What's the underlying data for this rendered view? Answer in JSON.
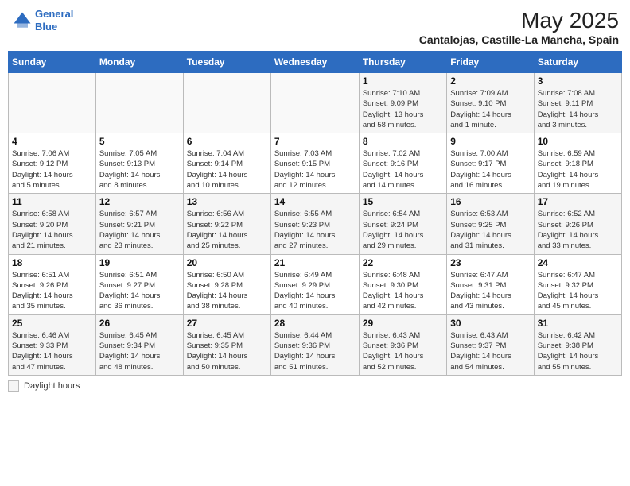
{
  "header": {
    "logo_line1": "General",
    "logo_line2": "Blue",
    "month_year": "May 2025",
    "location": "Cantalojas, Castille-La Mancha, Spain"
  },
  "weekdays": [
    "Sunday",
    "Monday",
    "Tuesday",
    "Wednesday",
    "Thursday",
    "Friday",
    "Saturday"
  ],
  "weeks": [
    [
      {
        "day": "",
        "info": ""
      },
      {
        "day": "",
        "info": ""
      },
      {
        "day": "",
        "info": ""
      },
      {
        "day": "",
        "info": ""
      },
      {
        "day": "1",
        "info": "Sunrise: 7:10 AM\nSunset: 9:09 PM\nDaylight: 13 hours\nand 58 minutes."
      },
      {
        "day": "2",
        "info": "Sunrise: 7:09 AM\nSunset: 9:10 PM\nDaylight: 14 hours\nand 1 minute."
      },
      {
        "day": "3",
        "info": "Sunrise: 7:08 AM\nSunset: 9:11 PM\nDaylight: 14 hours\nand 3 minutes."
      }
    ],
    [
      {
        "day": "4",
        "info": "Sunrise: 7:06 AM\nSunset: 9:12 PM\nDaylight: 14 hours\nand 5 minutes."
      },
      {
        "day": "5",
        "info": "Sunrise: 7:05 AM\nSunset: 9:13 PM\nDaylight: 14 hours\nand 8 minutes."
      },
      {
        "day": "6",
        "info": "Sunrise: 7:04 AM\nSunset: 9:14 PM\nDaylight: 14 hours\nand 10 minutes."
      },
      {
        "day": "7",
        "info": "Sunrise: 7:03 AM\nSunset: 9:15 PM\nDaylight: 14 hours\nand 12 minutes."
      },
      {
        "day": "8",
        "info": "Sunrise: 7:02 AM\nSunset: 9:16 PM\nDaylight: 14 hours\nand 14 minutes."
      },
      {
        "day": "9",
        "info": "Sunrise: 7:00 AM\nSunset: 9:17 PM\nDaylight: 14 hours\nand 16 minutes."
      },
      {
        "day": "10",
        "info": "Sunrise: 6:59 AM\nSunset: 9:18 PM\nDaylight: 14 hours\nand 19 minutes."
      }
    ],
    [
      {
        "day": "11",
        "info": "Sunrise: 6:58 AM\nSunset: 9:20 PM\nDaylight: 14 hours\nand 21 minutes."
      },
      {
        "day": "12",
        "info": "Sunrise: 6:57 AM\nSunset: 9:21 PM\nDaylight: 14 hours\nand 23 minutes."
      },
      {
        "day": "13",
        "info": "Sunrise: 6:56 AM\nSunset: 9:22 PM\nDaylight: 14 hours\nand 25 minutes."
      },
      {
        "day": "14",
        "info": "Sunrise: 6:55 AM\nSunset: 9:23 PM\nDaylight: 14 hours\nand 27 minutes."
      },
      {
        "day": "15",
        "info": "Sunrise: 6:54 AM\nSunset: 9:24 PM\nDaylight: 14 hours\nand 29 minutes."
      },
      {
        "day": "16",
        "info": "Sunrise: 6:53 AM\nSunset: 9:25 PM\nDaylight: 14 hours\nand 31 minutes."
      },
      {
        "day": "17",
        "info": "Sunrise: 6:52 AM\nSunset: 9:26 PM\nDaylight: 14 hours\nand 33 minutes."
      }
    ],
    [
      {
        "day": "18",
        "info": "Sunrise: 6:51 AM\nSunset: 9:26 PM\nDaylight: 14 hours\nand 35 minutes."
      },
      {
        "day": "19",
        "info": "Sunrise: 6:51 AM\nSunset: 9:27 PM\nDaylight: 14 hours\nand 36 minutes."
      },
      {
        "day": "20",
        "info": "Sunrise: 6:50 AM\nSunset: 9:28 PM\nDaylight: 14 hours\nand 38 minutes."
      },
      {
        "day": "21",
        "info": "Sunrise: 6:49 AM\nSunset: 9:29 PM\nDaylight: 14 hours\nand 40 minutes."
      },
      {
        "day": "22",
        "info": "Sunrise: 6:48 AM\nSunset: 9:30 PM\nDaylight: 14 hours\nand 42 minutes."
      },
      {
        "day": "23",
        "info": "Sunrise: 6:47 AM\nSunset: 9:31 PM\nDaylight: 14 hours\nand 43 minutes."
      },
      {
        "day": "24",
        "info": "Sunrise: 6:47 AM\nSunset: 9:32 PM\nDaylight: 14 hours\nand 45 minutes."
      }
    ],
    [
      {
        "day": "25",
        "info": "Sunrise: 6:46 AM\nSunset: 9:33 PM\nDaylight: 14 hours\nand 47 minutes."
      },
      {
        "day": "26",
        "info": "Sunrise: 6:45 AM\nSunset: 9:34 PM\nDaylight: 14 hours\nand 48 minutes."
      },
      {
        "day": "27",
        "info": "Sunrise: 6:45 AM\nSunset: 9:35 PM\nDaylight: 14 hours\nand 50 minutes."
      },
      {
        "day": "28",
        "info": "Sunrise: 6:44 AM\nSunset: 9:36 PM\nDaylight: 14 hours\nand 51 minutes."
      },
      {
        "day": "29",
        "info": "Sunrise: 6:43 AM\nSunset: 9:36 PM\nDaylight: 14 hours\nand 52 minutes."
      },
      {
        "day": "30",
        "info": "Sunrise: 6:43 AM\nSunset: 9:37 PM\nDaylight: 14 hours\nand 54 minutes."
      },
      {
        "day": "31",
        "info": "Sunrise: 6:42 AM\nSunset: 9:38 PM\nDaylight: 14 hours\nand 55 minutes."
      }
    ]
  ],
  "legend": {
    "label": "Daylight hours"
  },
  "colors": {
    "header_bg": "#2d6cc0",
    "logo_blue": "#2d6cc0"
  }
}
